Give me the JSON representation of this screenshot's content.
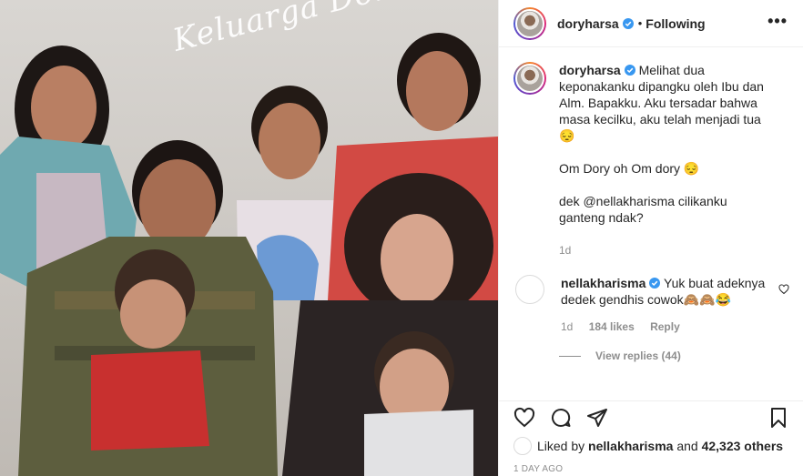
{
  "photo": {
    "signature": "Keluarga Donel"
  },
  "post": {
    "author": "doryharsa",
    "separator": "•",
    "follow_state": "Following",
    "more_icon": "more-horizontal-icon"
  },
  "caption": {
    "username": "doryharsa",
    "paragraph1": "Melihat dua keponakanku dipangku oleh Ibu dan Alm. Bapakku. Aku tersadar bahwa masa kecilku, aku telah menjadi tua 😔",
    "paragraph2": "Om Dory oh Om dory 😔",
    "paragraph3": "dek @nellakharisma cilikanku ganteng ndak?",
    "age": "1d"
  },
  "comment": {
    "username": "nellakharisma",
    "text": "Yuk buat adeknya dedek gendhis cowok🙈🙈😂",
    "age": "1d",
    "likes": "184 likes",
    "reply": "Reply",
    "view_replies": "View replies (44)"
  },
  "likes": {
    "prefix": "Liked by",
    "user": "nellakharisma",
    "and": "and",
    "others": "42,323 others"
  },
  "timestamp": "1 DAY AGO",
  "colors": {
    "verified_blue": "#3897f0",
    "text": "#262626",
    "muted": "#8e8e8e",
    "border": "#efefef"
  },
  "icons": [
    "heart-icon",
    "comment-icon",
    "share-icon",
    "bookmark-icon",
    "verified-badge-icon"
  ]
}
